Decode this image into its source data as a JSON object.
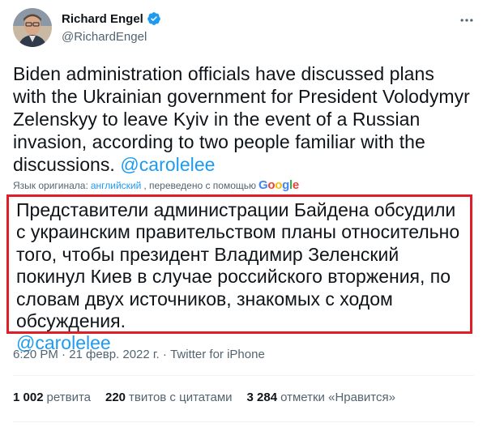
{
  "author": {
    "name": "Richard Engel",
    "handle": "@RichardEngel"
  },
  "tweet": {
    "text": "Biden administration officials have discussed plans with the Ukrainian government for President Volodymyr Zelenskyy to leave Kyiv in the event of a Russian invasion, according to two people familiar with the discussions. ",
    "mention": "@carolelee"
  },
  "translation": {
    "note_prefix": "Язык оригинала: ",
    "language": "английский",
    "note_suffix": ", переведено с помощью",
    "provider": "Google",
    "text": "Представители администрации Байдена обсудили с украинским правительством планы относительно того, чтобы президент Владимир Зеленский покинул Киев в случае российского вторжения, по словам двух источников, знакомых с ходом обсуждения.",
    "mention": "@carolelee"
  },
  "meta": {
    "time": "6:20 PM · 21 февр. 2022 г.",
    "separator": " · ",
    "source": "Twitter for iPhone"
  },
  "stats": {
    "retweets_count": "1 002",
    "retweets_label": "ретвита",
    "quotes_count": "220",
    "quotes_label": "твитов с цитатами",
    "likes_count": "3 284",
    "likes_label": "отметки «Нравится»"
  },
  "colors": {
    "accent": "#1d9bf0",
    "highlight_border": "#e01e2a",
    "text": "#0f1419",
    "secondary": "#536471"
  },
  "icons": [
    "avatar",
    "verified-badge-icon",
    "more-options-icon",
    "google-logo"
  ]
}
